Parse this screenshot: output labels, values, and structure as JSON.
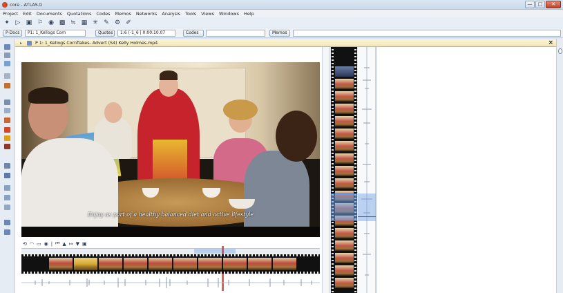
{
  "window": {
    "title": "core - ATLAS.ti",
    "minimize": "—",
    "maximize": "□",
    "close": "✕"
  },
  "menu": [
    "Project",
    "Edit",
    "Documents",
    "Quotations",
    "Codes",
    "Memos",
    "Networks",
    "Analysis",
    "Tools",
    "Views",
    "Windows",
    "Help"
  ],
  "selectors": {
    "documents_button": "P-Docs",
    "document_select": "P1: 1_Kellogs Corn",
    "quotes_button": "Quotes",
    "quote_select": "1:6 (-1_6 | 0:00:10.07",
    "codes_button": "Codes",
    "memos_button": "Memos"
  },
  "document_tab": {
    "label": "P 1: 1_Kellogs Cornflakes- Advert (S4) Kelly Holmes.mp4",
    "close": "×"
  },
  "video": {
    "subtitle": "Enjoy as part of a healthy balanced diet and active lifestyle"
  },
  "controls": {
    "buttons": [
      "⟲",
      "◠",
      "▭",
      "◉",
      "|",
      "⏮",
      "▲",
      "↦",
      "▼",
      "▣"
    ]
  },
  "colors": {
    "accent": "#d23a2a",
    "selection": "#6ea0e6",
    "tab_bg": "#f0e6b8"
  }
}
